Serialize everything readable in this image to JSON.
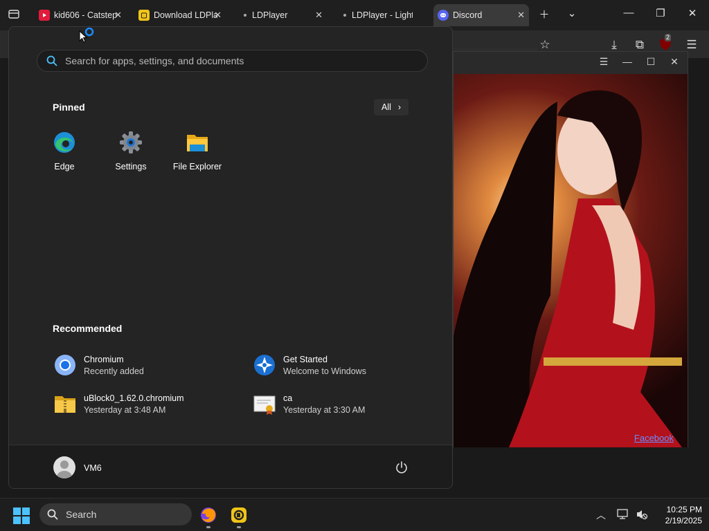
{
  "browser": {
    "tabs": [
      {
        "title": "kid606 - Catstep",
        "icon": "youtube-icon",
        "color": "#e21b3c"
      },
      {
        "title": "Download LDPla",
        "icon": "ldplayer-icon",
        "color": "#f0c419"
      },
      {
        "title": "LDPlayer",
        "icon": "loading-dot",
        "color": "#aaaaaa"
      },
      {
        "title": "LDPlayer - Light",
        "icon": "loading-dot",
        "color": "#aaaaaa"
      },
      {
        "title": "Discord",
        "icon": "discord-icon",
        "color": "#5865f2"
      }
    ],
    "active_tab": "Discord",
    "extension_badge": "2"
  },
  "image_window": {
    "link_text": "Facebook"
  },
  "start_menu": {
    "search_placeholder": "Search for apps, settings, and documents",
    "pinned_title": "Pinned",
    "all_label": "All",
    "pinned": [
      {
        "label": "Edge",
        "icon": "edge-icon"
      },
      {
        "label": "Settings",
        "icon": "settings-gear-icon"
      },
      {
        "label": "File Explorer",
        "icon": "folder-icon"
      }
    ],
    "recommended_title": "Recommended",
    "recommended": [
      {
        "name": "Chromium",
        "detail": "Recently added",
        "icon": "chromium-icon"
      },
      {
        "name": "Get Started",
        "detail": "Welcome to Windows",
        "icon": "get-started-icon"
      },
      {
        "name": "uBlock0_1.62.0.chromium",
        "detail": "Yesterday at 3:48 AM",
        "icon": "zip-folder-icon"
      },
      {
        "name": "ca",
        "detail": "Yesterday at 3:30 AM",
        "icon": "certificate-icon"
      }
    ],
    "user_name": "VM6"
  },
  "taskbar": {
    "search_label": "Search",
    "time": "10:25 PM",
    "date": "2/19/2025"
  }
}
